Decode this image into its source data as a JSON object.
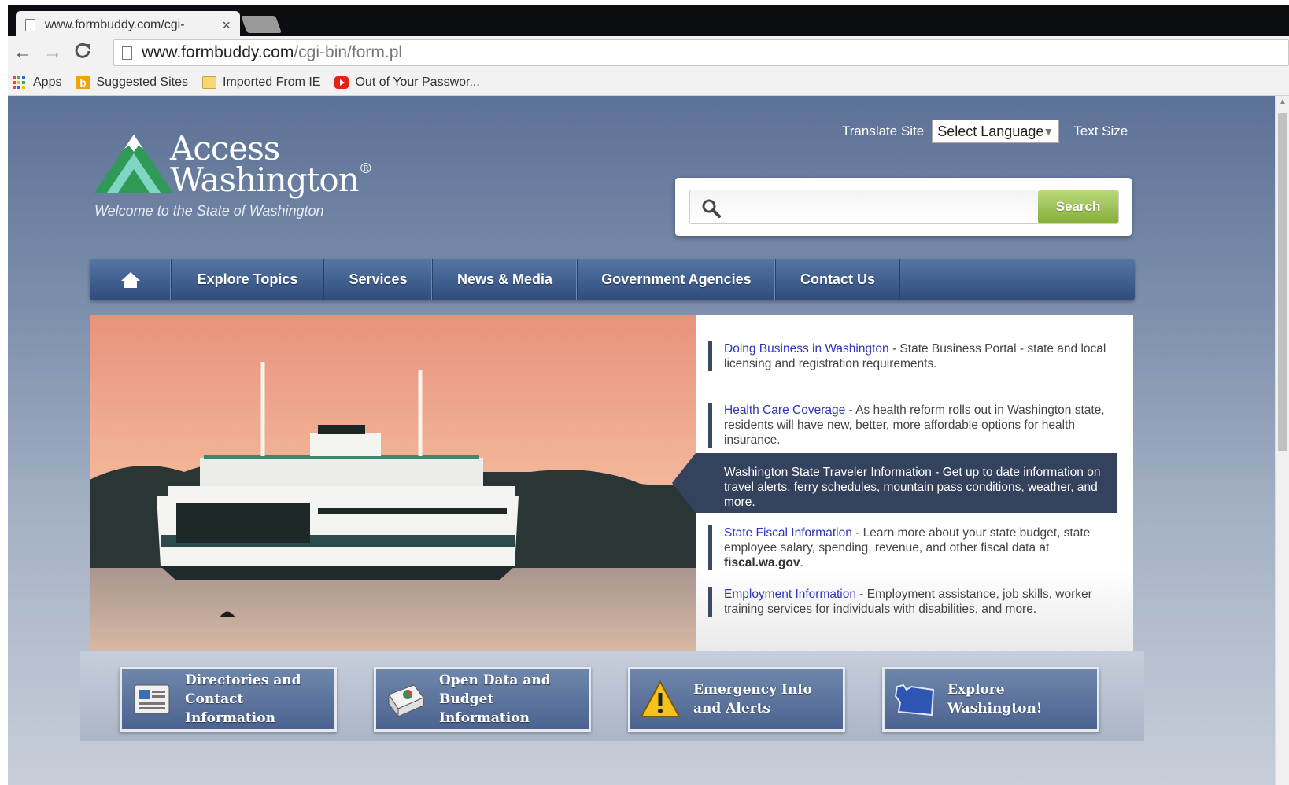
{
  "browser": {
    "tab_title": "www.formbuddy.com/cgi-",
    "tab_close": "×",
    "url_host": "www.formbuddy.com",
    "url_path": "/cgi-bin/form.pl",
    "nav": {
      "back": "←",
      "forward": "→",
      "reload": "C"
    },
    "bookmarks": [
      {
        "label": "Apps",
        "icon": "apps-grid-icon"
      },
      {
        "label": "Suggested Sites",
        "icon": "bing-icon"
      },
      {
        "label": "Imported From IE",
        "icon": "folder-icon"
      },
      {
        "label": "Out of Your Passwor...",
        "icon": "youtube-icon"
      }
    ]
  },
  "site": {
    "logo": {
      "line1": "Access",
      "line2": "Washington",
      "registered": "®",
      "tagline": "Welcome to the State of Washington"
    },
    "translate_label": "Translate Site",
    "language_select": "Select Language",
    "text_size": "Text Size",
    "search": {
      "placeholder": "",
      "button": "Search"
    },
    "nav": [
      "Explore Topics",
      "Services",
      "News & Media",
      "Government Agencies",
      "Contact Us"
    ],
    "features": [
      {
        "link": "Doing Business in Washington",
        "text": " - State Business Portal - state and local licensing and registration requirements."
      },
      {
        "link": "Health Care Coverage",
        "text": " - As health reform rolls out in Washington state, residents will have new, better, more affordable options for health insurance."
      },
      {
        "link": "Washington State Traveler Information",
        "text": " - Get up to date information on travel alerts, ferry schedules, mountain pass conditions, weather, and more."
      },
      {
        "link": "State Fiscal Information",
        "text": " - Learn more about your state budget, state employee salary, spending, revenue, and other fiscal data at ",
        "bold": "fiscal.wa.gov",
        "tail": "."
      },
      {
        "link": "Employment Information",
        "text": " - Employment assistance, job skills, worker training services for individuals with disabilities, and more."
      }
    ],
    "quick_links": [
      {
        "line1": "Directories and",
        "line2": "Contact Information",
        "icon": "directory-card-icon"
      },
      {
        "line1": "Open Data and",
        "line2": "Budget Information",
        "icon": "data-chart-icon"
      },
      {
        "line1": "Emergency Info",
        "line2": "and Alerts",
        "icon": "warning-triangle-icon"
      },
      {
        "line1": "Explore",
        "line2": "Washington!",
        "icon": "washington-map-icon"
      }
    ]
  },
  "colors": {
    "nav_blue": "#3a5a8a",
    "search_green": "#94bb4a",
    "link_blue": "#2e35b8",
    "active_item": "#34425e"
  }
}
